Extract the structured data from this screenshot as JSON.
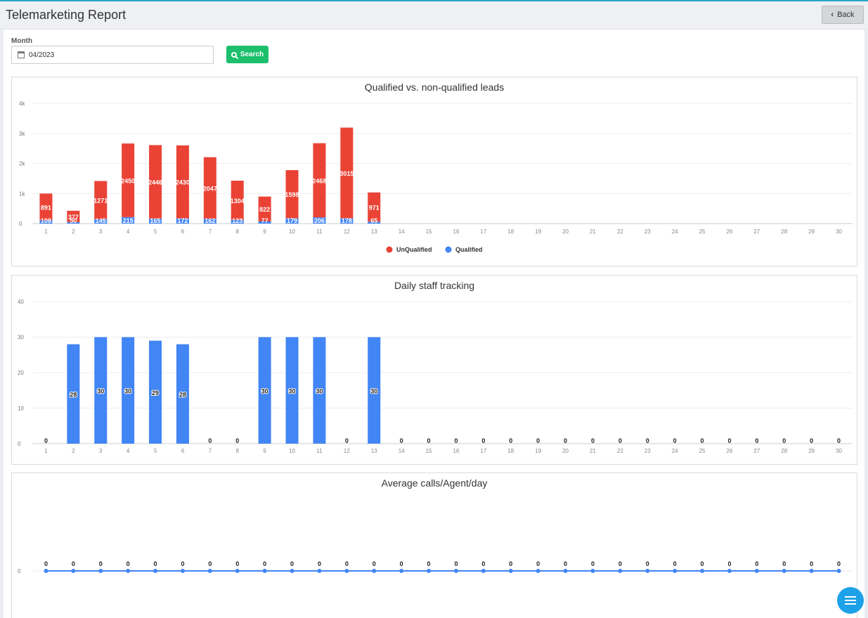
{
  "header": {
    "title": "Telemarketing Report",
    "back_label": "Back"
  },
  "filter": {
    "month_label": "Month",
    "month_value": "04/2023",
    "search_label": "Search"
  },
  "colors": {
    "unqualified": "#ea4335",
    "qualified": "#4285f4",
    "search_button": "#1cbf6c",
    "fab": "#1da1e8"
  },
  "icons": {
    "back": "chevron-left-icon",
    "month": "calendar-icon",
    "search": "search-icon",
    "fab": "list-icon"
  },
  "chart_data": [
    {
      "type": "bar",
      "stacked": true,
      "title": "Qualified vs. non-qualified leads",
      "categories": [
        "1",
        "2",
        "3",
        "4",
        "5",
        "6",
        "7",
        "8",
        "9",
        "10",
        "11",
        "12",
        "13",
        "14",
        "15",
        "16",
        "17",
        "18",
        "19",
        "20",
        "21",
        "22",
        "23",
        "24",
        "25",
        "26",
        "27",
        "28",
        "29",
        "30"
      ],
      "series": [
        {
          "name": "UnQualified",
          "color": "#ea4335",
          "values": [
            891,
            377,
            1271,
            2450,
            2446,
            2430,
            2047,
            1304,
            822,
            1598,
            2468,
            3015,
            971,
            0,
            0,
            0,
            0,
            0,
            0,
            0,
            0,
            0,
            0,
            0,
            0,
            0,
            0,
            0,
            0,
            0
          ]
        },
        {
          "name": "Qualified",
          "color": "#4285f4",
          "values": [
            108,
            50,
            145,
            215,
            165,
            172,
            162,
            123,
            77,
            179,
            206,
            178,
            65,
            0,
            0,
            0,
            0,
            0,
            0,
            0,
            0,
            0,
            0,
            0,
            0,
            0,
            0,
            0,
            0,
            0
          ]
        }
      ],
      "ylim": [
        0,
        4000
      ],
      "yticks": [
        "0",
        "1k",
        "2k",
        "3k",
        "4k"
      ],
      "legend": "bottom-center",
      "grid": true
    },
    {
      "type": "bar",
      "title": "Daily staff tracking",
      "categories": [
        "1",
        "2",
        "3",
        "4",
        "5",
        "6",
        "7",
        "8",
        "9",
        "10",
        "11",
        "12",
        "13",
        "14",
        "15",
        "16",
        "17",
        "18",
        "19",
        "20",
        "21",
        "22",
        "23",
        "24",
        "25",
        "26",
        "27",
        "28",
        "29",
        "30"
      ],
      "series": [
        {
          "color": "#4285f4",
          "values": [
            0,
            28,
            30,
            30,
            29,
            28,
            0,
            0,
            30,
            30,
            30,
            0,
            30,
            0,
            0,
            0,
            0,
            0,
            0,
            0,
            0,
            0,
            0,
            0,
            0,
            0,
            0,
            0,
            0,
            0
          ]
        }
      ],
      "ylim": [
        0,
        40
      ],
      "yticks": [
        "0",
        "10",
        "20",
        "30",
        "40"
      ],
      "grid": true
    },
    {
      "type": "line",
      "title": "Average calls/Agent/day",
      "categories": [
        "1",
        "2",
        "3",
        "4",
        "5",
        "6",
        "7",
        "8",
        "9",
        "10",
        "11",
        "12",
        "13",
        "14",
        "15",
        "16",
        "17",
        "18",
        "19",
        "20",
        "21",
        "22",
        "23",
        "24",
        "25",
        "26",
        "27",
        "28",
        "29",
        "30"
      ],
      "series": [
        {
          "color": "#4285f4",
          "values": [
            0,
            0,
            0,
            0,
            0,
            0,
            0,
            0,
            0,
            0,
            0,
            0,
            0,
            0,
            0,
            0,
            0,
            0,
            0,
            0,
            0,
            0,
            0,
            0,
            0,
            0,
            0,
            0,
            0,
            0
          ]
        }
      ],
      "yticks": [
        "0"
      ],
      "grid": true
    }
  ]
}
